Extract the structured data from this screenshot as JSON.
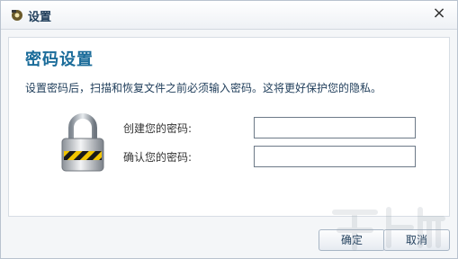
{
  "window": {
    "title": "设置",
    "close_symbol": "×"
  },
  "content": {
    "heading": "密码设置",
    "description": "设置密码后，扫描和恢复文件之前必须输入密码。这将更好保护您的隐私。"
  },
  "form": {
    "create_label": "创建您的密码:",
    "confirm_label": "确认您的密码:",
    "create_value": "",
    "confirm_value": ""
  },
  "buttons": {
    "ok_label": "确定",
    "cancel_label": "取消"
  },
  "icons": {
    "app": "app-gear-icon",
    "lock": "padlock-icon",
    "close": "close-icon"
  },
  "colors": {
    "heading": "#1b6c9a",
    "title": "#1f3d5a",
    "border": "#b9c3cf"
  }
}
